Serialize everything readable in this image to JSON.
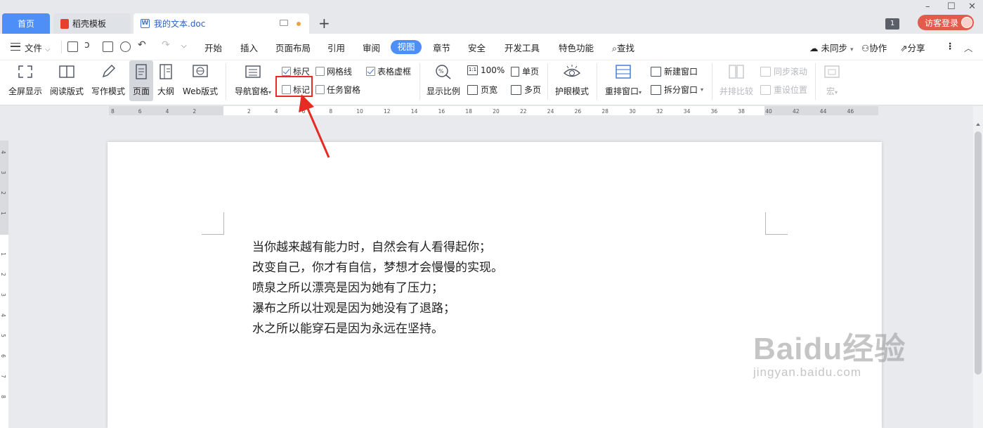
{
  "tabs": {
    "home": "首页",
    "daoke": "稻壳模板",
    "document": "我的文本.doc",
    "new_tab": "+"
  },
  "window": {
    "minimize": "–",
    "maximize": "☐",
    "close": "✕",
    "badge": "1",
    "login": "访客登录"
  },
  "menubar": {
    "file": "文件",
    "items": [
      "开始",
      "插入",
      "页面布局",
      "引用",
      "审阅",
      "视图",
      "章节",
      "安全",
      "开发工具",
      "特色功能"
    ],
    "active": "视图",
    "search": "查找",
    "sync": "未同步",
    "collab": "协作",
    "share": "分享",
    "more": "⋮",
    "collapse": "︿"
  },
  "ribbon": {
    "fullscreen": "全屏显示",
    "reading": "阅读版式",
    "writing": "写作模式",
    "page": "页面",
    "outline": "大纲",
    "web": "Web版式",
    "nav_pane": "导航窗格",
    "ruler": "标尺",
    "gridlines": "网格线",
    "table_gridlines": "表格虚框",
    "marks": "标记",
    "task_pane": "任务窗格",
    "zoom": "显示比例",
    "zoom_100": "100%",
    "single_page": "单页",
    "page_width": "页宽",
    "multi_page": "多页",
    "eye_protect": "护眼模式",
    "rearrange": "重排窗口",
    "new_window": "新建窗口",
    "split_window": "拆分窗口",
    "side_by_side": "并排比较",
    "sync_scroll": "同步滚动",
    "reset_position": "重设位置",
    "macro": "宏"
  },
  "checkbox_state": {
    "ruler": true,
    "gridlines": false,
    "table_gridlines": true,
    "marks": false,
    "task_pane": false
  },
  "ruler": {
    "h_ticks": [
      "8",
      "6",
      "4",
      "2",
      "",
      "2",
      "4",
      "6",
      "8",
      "10",
      "12",
      "14",
      "16",
      "18",
      "20",
      "22",
      "24",
      "26",
      "28",
      "30",
      "32",
      "34",
      "36",
      "38",
      "40",
      "42",
      "44",
      "46"
    ],
    "v_ticks": [
      "4",
      "3",
      "2",
      "1",
      "",
      "1",
      "2",
      "3",
      "4",
      "5",
      "6",
      "7",
      "8"
    ]
  },
  "document": {
    "lines": [
      "当你越来越有能力时，自然会有人看得起你；",
      "改变自己，你才有自信，梦想才会慢慢的实现。",
      "喷泉之所以漂亮是因为她有了压力；",
      "瀑布之所以壮观是因为她没有了退路；",
      "水之所以能穿石是因为永远在坚持。"
    ]
  },
  "watermark": {
    "logo": "Baidu经验",
    "url": "jingyan.baidu.com"
  },
  "colors": {
    "accent": "#4e8ef7",
    "login": "#e25c4b",
    "annotation": "#e52b22"
  }
}
